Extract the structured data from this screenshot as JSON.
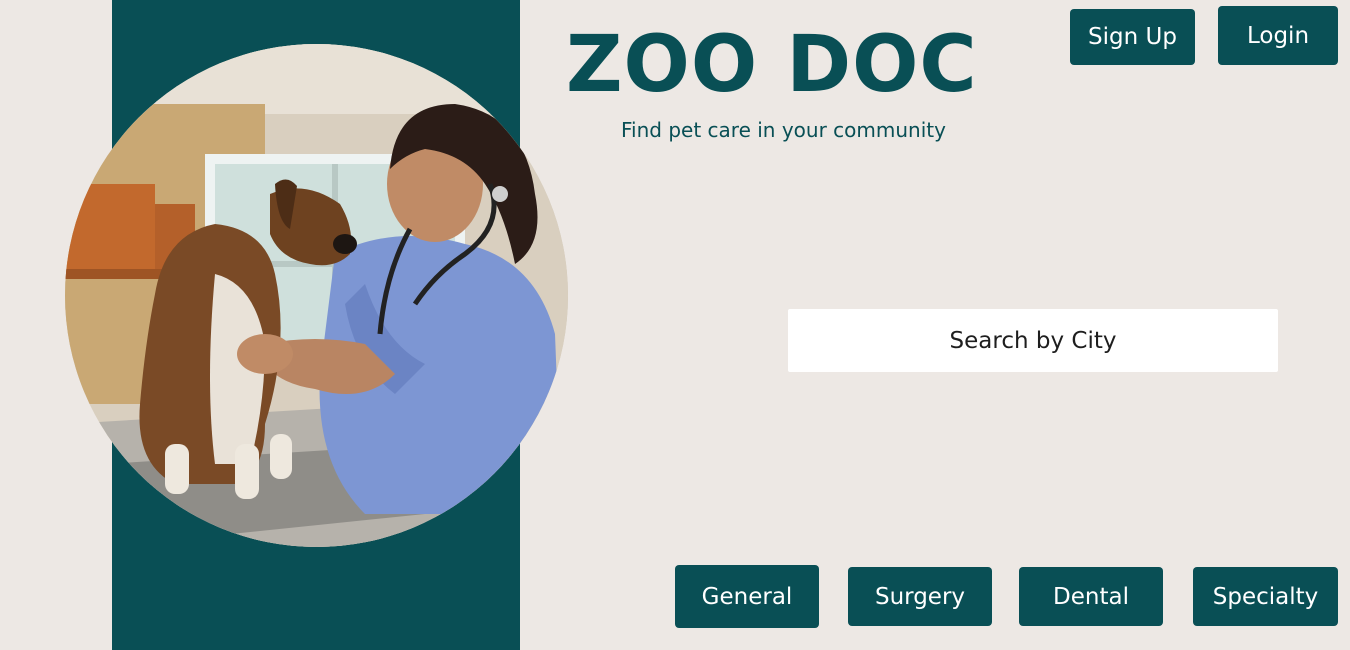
{
  "brand": {
    "title": "ZOO DOC",
    "tagline": "Find pet care in your community"
  },
  "header": {
    "signup_label": "Sign Up",
    "login_label": "Login"
  },
  "search": {
    "placeholder": "Search by City"
  },
  "categories": {
    "general": "General",
    "surgery": "Surgery",
    "dental": "Dental",
    "specialty": "Specialty"
  },
  "theme": {
    "primary": "#094f55",
    "background": "#ede8e4",
    "button_text": "#ffffff"
  }
}
